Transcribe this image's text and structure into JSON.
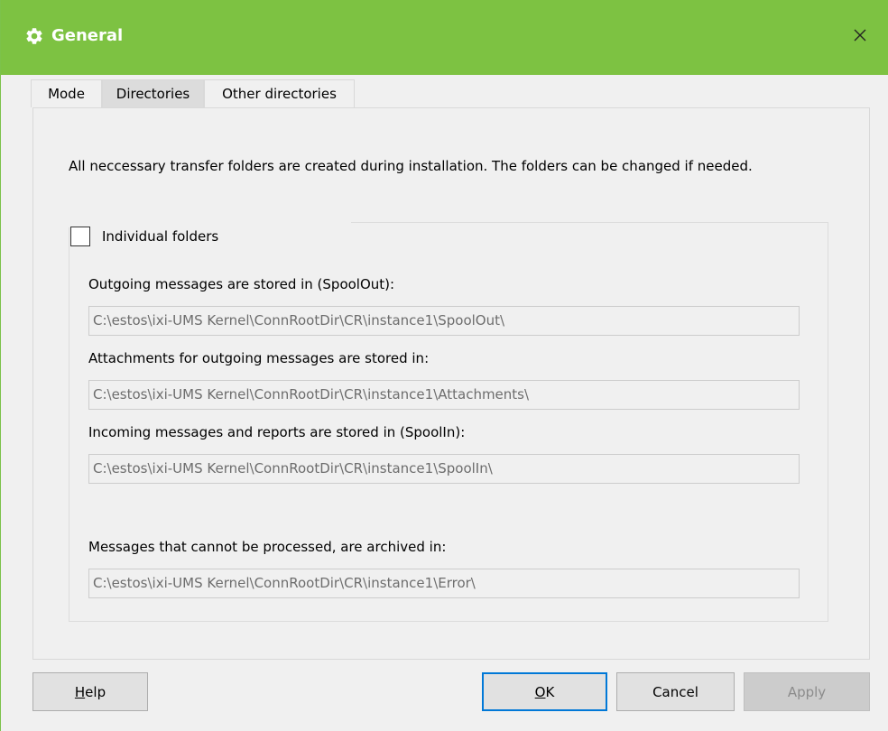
{
  "window": {
    "title": "General",
    "close_glyph": "✕",
    "colors": {
      "titlebar": "#7dc242",
      "title_text": "#ffffff"
    }
  },
  "tabs": [
    {
      "label": "Mode",
      "active": false
    },
    {
      "label": "Directories",
      "active": true
    },
    {
      "label": "Other directories",
      "active": false
    }
  ],
  "content": {
    "intro_text": "All neccessary transfer folders are created during installation. The folders can be changed if needed.",
    "individual_folders": {
      "label": "Individual folders",
      "checked": false
    },
    "spoolout": {
      "label": "Outgoing messages are stored in (SpoolOut):",
      "value": "C:\\estos\\ixi-UMS Kernel\\ConnRootDir\\CR\\instance1\\SpoolOut\\"
    },
    "attachments": {
      "label": "Attachments for outgoing messages are stored in:",
      "value": "C:\\estos\\ixi-UMS Kernel\\ConnRootDir\\CR\\instance1\\Attachments\\"
    },
    "spoolin": {
      "label": "Incoming messages and reports are stored in (SpoolIn):",
      "value": "C:\\estos\\ixi-UMS Kernel\\ConnRootDir\\CR\\instance1\\SpoolIn\\"
    },
    "error": {
      "label": "Messages that cannot be processed, are archived in:",
      "value": "C:\\estos\\ixi-UMS Kernel\\ConnRootDir\\CR\\instance1\\Error\\"
    }
  },
  "buttons": {
    "help": {
      "first": "H",
      "rest": "elp"
    },
    "ok": {
      "first": "O",
      "rest": "K"
    },
    "cancel": "Cancel",
    "apply": "Apply"
  }
}
